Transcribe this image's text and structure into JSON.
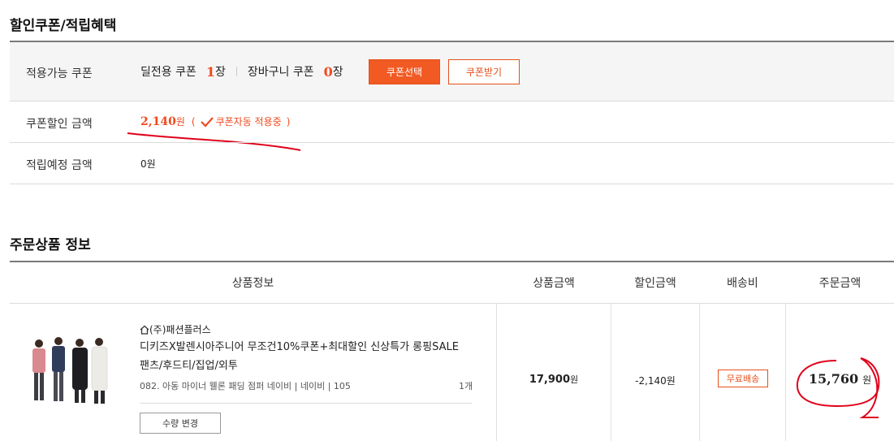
{
  "coupon_section": {
    "title": "할인쿠폰/적립혜택",
    "applicable_label": "적용가능 쿠폰",
    "deal_coupon_label": "딜전용 쿠폰",
    "deal_coupon_count": "1",
    "deal_coupon_unit": "장",
    "cart_coupon_label": "장바구니 쿠폰",
    "cart_coupon_count": "0",
    "cart_coupon_unit": "장",
    "select_button": "쿠폰선택",
    "receive_button": "쿠폰받기",
    "discount_label": "쿠폰할인 금액",
    "discount_amount": "2,140",
    "discount_unit": "원",
    "auto_apply_open": "(",
    "auto_apply_text": "쿠폰자동 적용중",
    "auto_apply_close": ")",
    "points_label": "적립예정 금액",
    "points_value": "0원"
  },
  "order_section": {
    "title": "주문상품 정보",
    "headers": [
      "상품정보",
      "상품금액",
      "할인금액",
      "배송비",
      "주문금액"
    ],
    "item": {
      "seller": "(주)패션플러스",
      "name_line1": "디키즈X발렌시아주니어 무조건10%쿠폰+최대할인 신상특가 롱핑SALE",
      "name_line2": "팬츠/후드티/집업/외투",
      "option": "082. 아동 마이너 웰론 패딩 점퍼 네이비 | 네이비 | 105",
      "quantity": "1개",
      "qty_change_button": "수량 변경",
      "price": "17,900",
      "price_unit": "원",
      "discount": "-2,140원",
      "shipping": "무료배송",
      "order_amount": "15,760",
      "order_unit": "원"
    }
  },
  "colors": {
    "accent": "#f25a23",
    "annotation": "#e0001a"
  },
  "icons": {
    "check": "check-icon",
    "home": "home-icon"
  }
}
